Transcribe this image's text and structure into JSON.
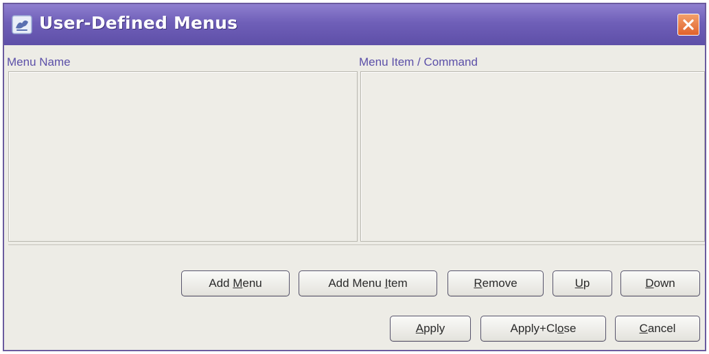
{
  "window": {
    "title": "User-Defined Menus",
    "accent_color": "#6f5fb8",
    "close_icon": "close-icon"
  },
  "columns": {
    "menu_name": "Menu Name",
    "menu_item_command": "Menu Item / Command"
  },
  "buttons": {
    "add_menu": {
      "pre": "Add ",
      "mnemonic": "M",
      "post": "enu"
    },
    "add_menu_item": {
      "pre": "Add Menu ",
      "mnemonic": "I",
      "post": "tem"
    },
    "remove": {
      "pre": "",
      "mnemonic": "R",
      "post": "emove"
    },
    "up": {
      "pre": "",
      "mnemonic": "U",
      "post": "p"
    },
    "down": {
      "pre": "",
      "mnemonic": "D",
      "post": "own"
    },
    "apply": {
      "pre": "",
      "mnemonic": "A",
      "post": "pply"
    },
    "apply_close": {
      "pre": "Apply+Cl",
      "mnemonic": "o",
      "post": "se"
    },
    "cancel": {
      "pre": "",
      "mnemonic": "C",
      "post": "ancel"
    }
  }
}
